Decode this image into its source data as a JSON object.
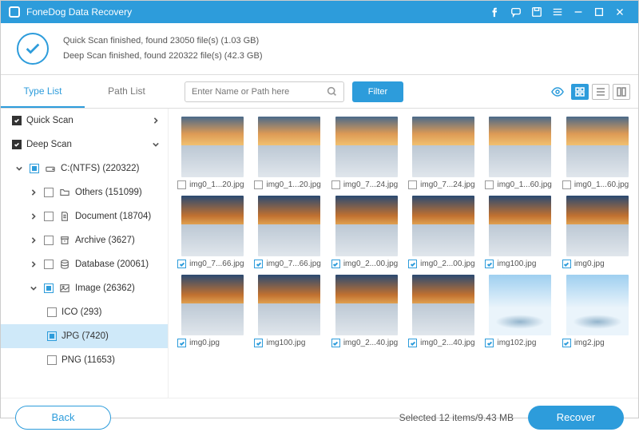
{
  "app": {
    "title": "FoneDog Data Recovery"
  },
  "summary": {
    "line1": "Quick Scan finished, found 23050 file(s) (1.03 GB)",
    "line2": "Deep Scan finished, found 220322 file(s) (42.3 GB)"
  },
  "tabs": {
    "type": "Type List",
    "path": "Path List"
  },
  "search": {
    "placeholder": "Enter Name or Path here"
  },
  "filter": {
    "label": "Filter"
  },
  "tree": {
    "quick": "Quick Scan",
    "deep": "Deep Scan",
    "drive": "C:(NTFS) (220322)",
    "others": "Others (151099)",
    "document": "Document (18704)",
    "archive": "Archive (3627)",
    "database": "Database (20061)",
    "image": "Image (26362)",
    "ico": "ICO (293)",
    "jpg": "JPG (7420)",
    "png": "PNG (11653)"
  },
  "items": [
    {
      "name": "img0_1...20.jpg",
      "checked": false,
      "v": 1
    },
    {
      "name": "img0_1...20.jpg",
      "checked": false,
      "v": 1
    },
    {
      "name": "img0_7...24.jpg",
      "checked": false,
      "v": 1
    },
    {
      "name": "img0_7...24.jpg",
      "checked": false,
      "v": 1
    },
    {
      "name": "img0_1...60.jpg",
      "checked": false,
      "v": 1
    },
    {
      "name": "img0_1...60.jpg",
      "checked": false,
      "v": 1
    },
    {
      "name": "img0_7...66.jpg",
      "checked": true,
      "v": 2
    },
    {
      "name": "img0_7...66.jpg",
      "checked": true,
      "v": 2
    },
    {
      "name": "img0_2...00.jpg",
      "checked": true,
      "v": 2
    },
    {
      "name": "img0_2...00.jpg",
      "checked": true,
      "v": 2
    },
    {
      "name": "img100.jpg",
      "checked": true,
      "v": 2
    },
    {
      "name": "img0.jpg",
      "checked": true,
      "v": 2
    },
    {
      "name": "img0.jpg",
      "checked": true,
      "v": 2
    },
    {
      "name": "img100.jpg",
      "checked": true,
      "v": 2
    },
    {
      "name": "img0_2...40.jpg",
      "checked": true,
      "v": 2
    },
    {
      "name": "img0_2...40.jpg",
      "checked": true,
      "v": 2
    },
    {
      "name": "img102.jpg",
      "checked": true,
      "v": 3
    },
    {
      "name": "img2.jpg",
      "checked": true,
      "v": 3
    }
  ],
  "footer": {
    "back": "Back",
    "selected": "Selected 12 items/9.43 MB",
    "recover": "Recover"
  }
}
